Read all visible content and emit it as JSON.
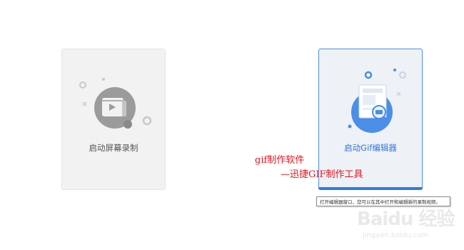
{
  "cards": [
    {
      "label": "启动屏幕录制",
      "icon": "video-clapper-icon"
    },
    {
      "label": "启动Gif编辑器",
      "icon": "gif-editor-document-icon"
    }
  ],
  "tooltip": "打开编辑器窗口，您可以在其中打开和编辑新的录制视频。",
  "annotation": {
    "line1": "gif制作软件",
    "line2": "—迅捷GIF制作工具"
  },
  "watermark": {
    "logo": "Baidu 经验",
    "url": "jingyan.baidu.com"
  },
  "colors": {
    "accent": "#2f7be0",
    "annotation": "#e8131b"
  }
}
